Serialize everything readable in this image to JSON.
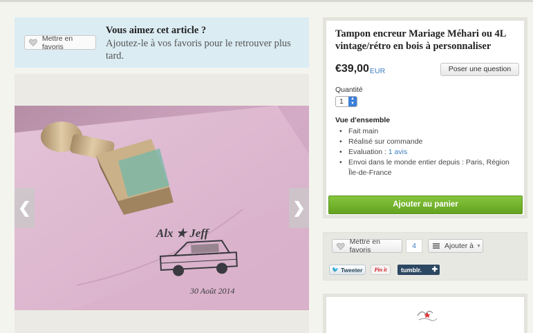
{
  "favorite_banner": {
    "button_label": "Mettre en favoris",
    "title": "Vous aimez cet article ?",
    "subtitle": "Ajoutez-le à vos favoris pour le retrouver plus tard."
  },
  "gallery": {
    "image_text_line1": "Alx ★ Jeff",
    "image_text_line2": "30 Août 2014",
    "stamp_text": "Alx Jeff",
    "prev_glyph": "❮",
    "next_glyph": "❯"
  },
  "product": {
    "title": "Tampon encreur Mariage Méhari ou 4L vintage/rétro en bois à personnaliser",
    "price": "€39,00",
    "currency": "EUR",
    "ask_button": "Poser une question",
    "quantity_label": "Quantité",
    "quantity_value": "1",
    "overview_title": "Vue d'ensemble",
    "overview_items": {
      "handmade": "Fait main",
      "made_to_order": "Réalisé sur commande",
      "rating_prefix": "Evaluation : ",
      "rating_link": "1 avis",
      "shipping": "Envoi dans le monde entier depuis : Paris, Région Île-de-France"
    },
    "add_to_cart": "Ajouter au panier"
  },
  "social": {
    "favorite_label": "Mettre en favoris",
    "favorite_count": "4",
    "add_to_label": "Ajouter à",
    "tweet_label": "Tweeter",
    "pinit_label": "Pin it",
    "tumblr_label": "tumblr.",
    "tumblr_plus": "✚"
  },
  "icons": {
    "heart": "heart-icon",
    "list": "list-icon",
    "twitter": "twitter-bird-icon",
    "arrow_left": "chevron-left-icon",
    "arrow_right": "chevron-right-icon"
  },
  "colors": {
    "banner_bg": "#dbecf3",
    "cart_green": "#6fae2a",
    "link_blue": "#3a7bbf",
    "tumblr_navy": "#2c4762"
  }
}
